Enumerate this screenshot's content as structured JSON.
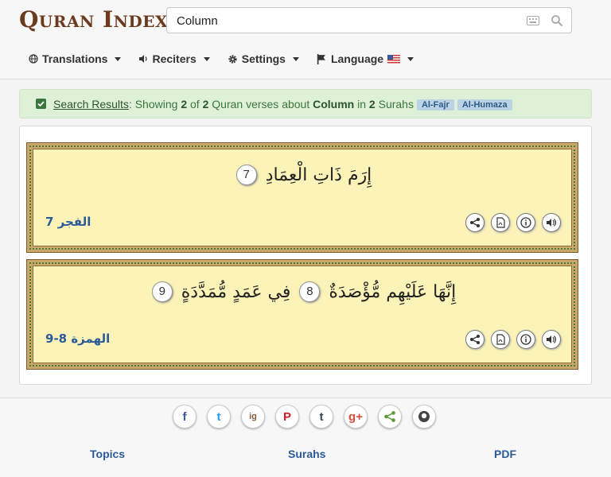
{
  "header": {
    "logo": "Quran Index",
    "search": {
      "value": "Column"
    },
    "menu": [
      {
        "label": "Translations",
        "icon": "globe-icon"
      },
      {
        "label": "Reciters",
        "icon": "speaker-icon"
      },
      {
        "label": "Settings",
        "icon": "gear-icon"
      },
      {
        "label": "Language",
        "icon": "flag-icon"
      }
    ]
  },
  "results": {
    "link": "Search Results",
    "t1": ": Showing ",
    "count": "2",
    "t2": " of ",
    "total": "2",
    "t3": " Quran verses about ",
    "term": "Column",
    "t4": " in ",
    "surahs": "2",
    "t5": " Surahs",
    "tags": [
      "Al-Fajr",
      "Al-Humaza"
    ]
  },
  "verses": [
    {
      "text": "إِرَمَ ذَاتِ الْعِمَادِ",
      "num": "7",
      "ref": "الفجر 7"
    },
    {
      "text_a": "إِنَّهَا عَلَيْهِم مُّؤْصَدَةٌ",
      "num_a": "8",
      "text_b": "فِي عَمَدٍ مُّمَدَّدَةٍ",
      "num_b": "9",
      "ref": "الهمزة 8-9"
    }
  ],
  "footer": {
    "social": [
      "f",
      "t",
      "ig",
      "P",
      "t",
      "g+",
      "share",
      "gh"
    ],
    "links_row1": [
      "Topics",
      "Surahs",
      "PDF"
    ]
  },
  "colors": {
    "accent": "#2c5a9a",
    "success_bg": "#dff0d8",
    "verse_bg": "#fbf3b8"
  }
}
